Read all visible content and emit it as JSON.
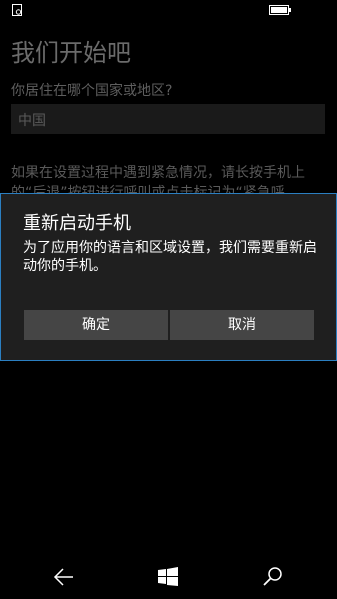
{
  "status_bar": {
    "left_icon": "notification-icon",
    "battery_icon": "battery-icon"
  },
  "page": {
    "title": "我们开始吧",
    "region_question": "你居住在哪个国家或地区?",
    "region_value": "中国",
    "emergency_text": "如果在设置过程中遇到紧急情况，请长按手机上的“后退”按钮进行呼叫或点击标记为“紧急呼"
  },
  "dialog": {
    "title": "重新启动手机",
    "message": "为了应用你的语言和区域设置，我们需要重新启动你的手机。",
    "confirm_label": "确定",
    "cancel_label": "取消",
    "border_color": "#2b7fc1"
  },
  "nav_bar": {
    "back_icon": "back-arrow-icon",
    "home_icon": "windows-logo-icon",
    "search_icon": "search-icon"
  }
}
